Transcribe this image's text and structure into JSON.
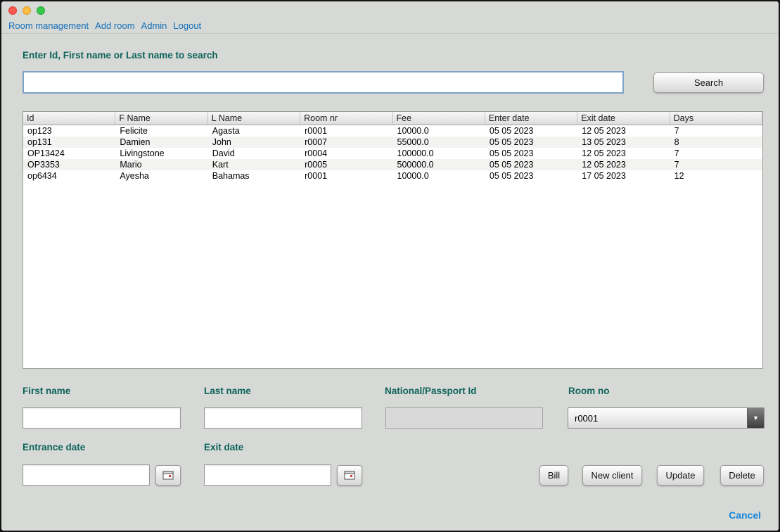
{
  "window": {
    "controls": [
      "close",
      "minimize",
      "zoom"
    ]
  },
  "menu": {
    "items": [
      "Room management",
      "Add room",
      "Admin",
      "Logout"
    ]
  },
  "search": {
    "label": "Enter Id, First name or Last name to search",
    "value": "",
    "button_label": "Search"
  },
  "table": {
    "columns": [
      "Id",
      "F Name",
      "L Name",
      "Room nr",
      "Fee",
      "Enter date",
      "Exit date",
      "Days"
    ],
    "rows": [
      [
        "op123",
        "Felicite",
        "Agasta",
        "r0001",
        "10000.0",
        "05 05 2023",
        "12 05 2023",
        "7"
      ],
      [
        "op131",
        "Damien",
        "John",
        "r0007",
        "55000.0",
        "05 05 2023",
        "13 05 2023",
        "8"
      ],
      [
        "OP13424",
        "Livingstone",
        "David",
        "r0004",
        "100000.0",
        "05 05 2023",
        "12 05 2023",
        "7"
      ],
      [
        "OP3353",
        "Mario",
        "Kart",
        "r0005",
        "500000.0",
        "05 05 2023",
        "12 05 2023",
        "7"
      ],
      [
        "op6434",
        "Ayesha",
        "Bahamas",
        "r0001",
        "10000.0",
        "05 05 2023",
        "17 05 2023",
        "12"
      ]
    ]
  },
  "form": {
    "first_name": {
      "label": "First name",
      "value": ""
    },
    "last_name": {
      "label": "Last name",
      "value": ""
    },
    "national_id": {
      "label": "National/Passport Id",
      "value": ""
    },
    "room_no": {
      "label": "Room no",
      "value": "r0001"
    },
    "entrance_date": {
      "label": "Entrance date",
      "value": ""
    },
    "exit_date": {
      "label": "Exit date",
      "value": ""
    }
  },
  "buttons": {
    "bill": "Bill",
    "new_client": "New client",
    "update": "Update",
    "delete": "Delete"
  },
  "footer": {
    "cancel": "Cancel"
  },
  "colors": {
    "window_bg": "#d6d9d5",
    "label_teal": "#0e635c",
    "menu_blue": "#1470ba",
    "cancel_blue": "#1487dd",
    "search_border_blue": "#7fa2c8"
  }
}
